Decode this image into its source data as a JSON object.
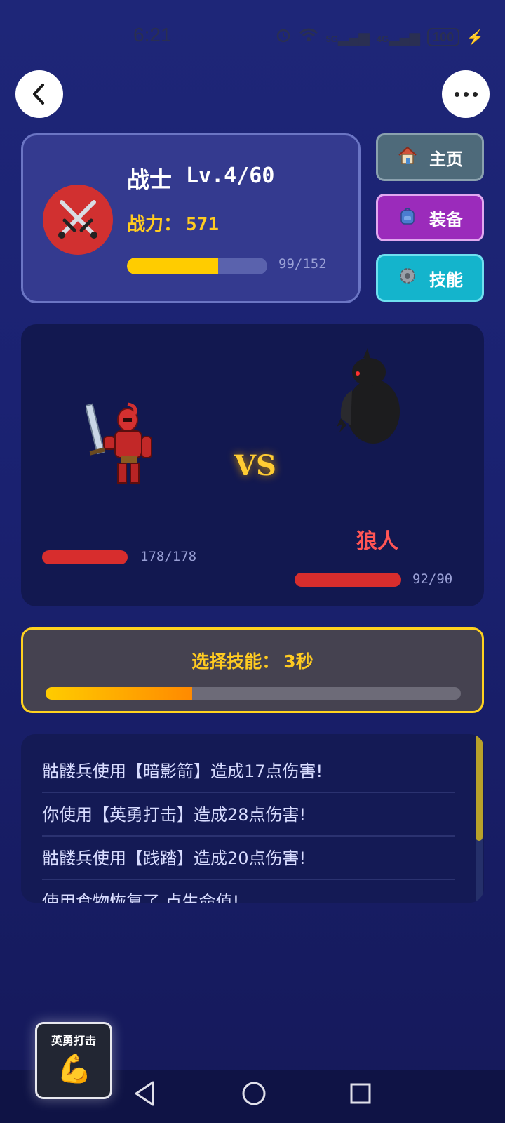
{
  "status": {
    "time": "6:21",
    "signal_5g": "5G",
    "signal_4g": "4G",
    "battery": "100"
  },
  "player": {
    "name": "战士",
    "level": "Lv.4/60",
    "power_label": "战力：",
    "power_value": "571",
    "xp_text": "99/152",
    "xp_fraction": 0.651
  },
  "side_buttons": [
    {
      "label": "主页",
      "icon": "house-icon"
    },
    {
      "label": "装备",
      "icon": "backpack-icon"
    },
    {
      "label": "技能",
      "icon": "gear-icon"
    }
  ],
  "battle": {
    "vs_label": "VS",
    "enemy_name": "狼人",
    "player_hp_text": "178/178",
    "player_hp_fraction": 1.0,
    "enemy_hp_text": "92/90",
    "enemy_hp_fraction": 1.0
  },
  "timer": {
    "label": "选择技能：",
    "seconds": "3秒",
    "progress_fraction": 0.353
  },
  "log": [
    "骷髅兵使用【暗影箭】造成17点伤害!",
    "你使用【英勇打击】造成28点伤害!",
    "骷髅兵使用【践踏】造成20点伤害!",
    "使用食物恢复了 点生命值!"
  ],
  "skill": {
    "name": "英勇打击",
    "icon": "flexed-biceps-icon"
  },
  "colors": {
    "accent_yellow": "#ffcb21",
    "hp_red": "#d72d2d",
    "enemy_name_red": "#ff5555"
  }
}
